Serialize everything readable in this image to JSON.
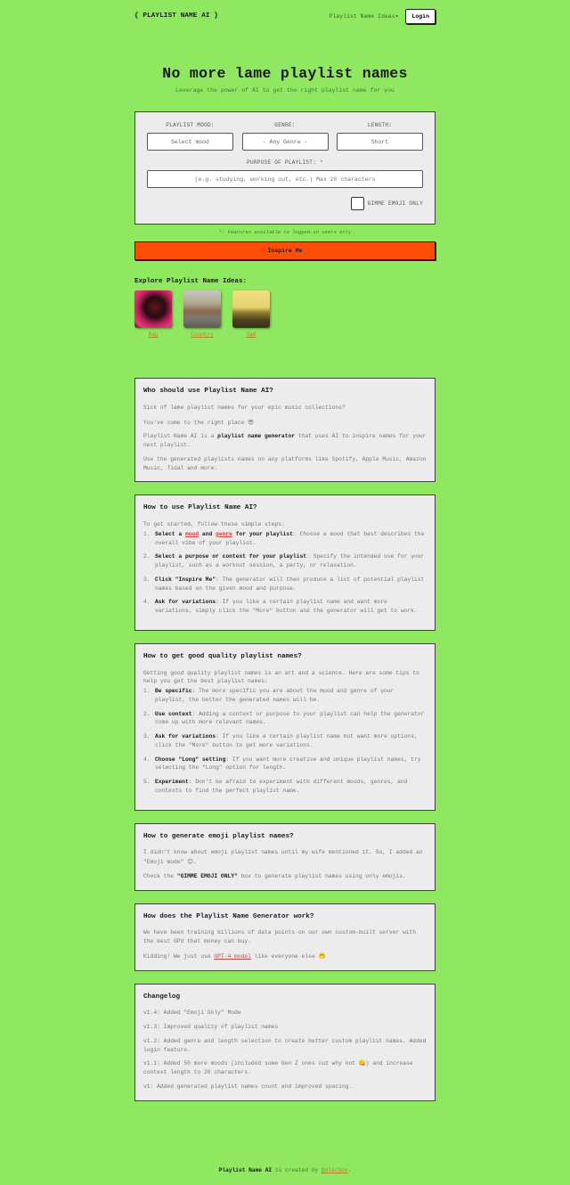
{
  "nav": {
    "logo": "{ PLAYLIST NAME AI }",
    "ideas_link": "Playlist Name Ideas",
    "ideas_caret": "▾",
    "login": "Login"
  },
  "hero": {
    "title": "No more lame playlist names",
    "subtitle": "Leverage the power of AI to get the right playlist name for you"
  },
  "form": {
    "mood_label": "PLAYLIST MOOD:",
    "mood_value": "Select mood",
    "genre_label": "GENRE:",
    "genre_value": "- Any Genre -",
    "length_label": "LENGTH:",
    "length_value": "Short",
    "purpose_label": "PURPOSE OF PLAYLIST:",
    "purpose_required": "*",
    "purpose_placeholder": "(e.g. studying, working out, etc.) Max 20 characters",
    "emoji_label": "GIMME EMOJI ONLY",
    "emoji_checked": false,
    "note": "*: Features available to logged-in users only",
    "inspire": "Inspire Me"
  },
  "explore": {
    "title": "Explore Playlist Name Ideas:",
    "items": [
      {
        "label": "Rap"
      },
      {
        "label": "Country"
      },
      {
        "label": "Sad"
      }
    ]
  },
  "who": {
    "title": "Who should use Playlist Name AI?",
    "p1": "Sick of lame playlist names for your epic music collections?",
    "p2": "You've come to the right place ",
    "p2_emoji": "😎",
    "p3_a": "Playlist Name AI is a ",
    "p3_b": "playlist name generator",
    "p3_c": " that uses AI to inspire names for your next playlist.",
    "p4": "Use the generated playlists names on any platforms like Spotify, Apple Music, Amazon Music, Tidal and more."
  },
  "howto": {
    "title": "How to use Playlist Name AI?",
    "intro": "To get started, follow these simple steps:",
    "s1_num": "1.",
    "s1_a": "Select a ",
    "s1_mood": "mood",
    "s1_and": " and ",
    "s1_genre": "genre",
    "s1_b": " for your playlist",
    "s1_text": ": Choose a mood that best describes the overall vibe of your playlist.",
    "s2_num": "2.",
    "s2_b": "Select a purpose or context for your playlist",
    "s2_text": ": Specify the intended use for your playlist, such as a workout session, a party, or relaxation.",
    "s3_num": "3.",
    "s3_b": "Click \"Inspire Me\"",
    "s3_text": ": The generator will then produce a list of potential playlist names based on the given mood and purpose.",
    "s4_num": "4.",
    "s4_b": "Ask for variations",
    "s4_text": ": If you like a certain playlist name and want more variations, simply click the \"More\" button and the generator will get to work."
  },
  "quality": {
    "title": "How to get good quality playlist names?",
    "intro": "Getting good quality playlist names is an art and a science. Here are some tips to help you get the best playlist names:",
    "tips": [
      {
        "num": "1.",
        "b": "Be specific",
        "text": ": The more specific you are about the mood and genre of your playlist, the better the generated names will be."
      },
      {
        "num": "2.",
        "b": "Use context",
        "text": ": Adding a context or purpose to your playlist can help the generator come up with more relevant names."
      },
      {
        "num": "3.",
        "b": "Ask for variations",
        "text": ": If you like a certain playlist name but want more options, click the \"More\" button to get more variations."
      },
      {
        "num": "4.",
        "b": "Choose \"Long\" setting",
        "text": ": If you want more creative and unique playlist names, try selecting the \"Long\" option for length."
      },
      {
        "num": "5.",
        "b": "Experiment",
        "text": ": Don't be afraid to experiment with different moods, genres, and contexts to find the perfect playlist name."
      }
    ]
  },
  "emoji": {
    "title": "How to generate emoji playlist names?",
    "p1": "I didn't know about emoji playlist names until my wife mentioned it. So, I added an \"Emoji mode\" ",
    "p1_emoji": "😊",
    "p1_end": ".",
    "p2_a": "Check the ",
    "p2_b": "\"GIMME EMOJI ONLY\"",
    "p2_c": " box to generate playlist names using only emojis."
  },
  "works": {
    "title": "How does the Playlist Name Generator work?",
    "p1": "We have been training billions of data points on our own custom-built server with the best GPU that money can buy.",
    "p2_a": "Kidding! We just use ",
    "p2_link": "GPT-4 model",
    "p2_c": " like everyone else ",
    "p2_emoji": "🤭"
  },
  "changelog": {
    "title": "Changelog",
    "entries": [
      {
        "text": "v1.4: Added \"Emoji Only\" Mode"
      },
      {
        "text": "v1.3: Improved quality of playlist names"
      },
      {
        "text": "v1.2: Added genre and length selection to create better custom playlist names. Added login feature."
      },
      {
        "text": "v1.1: Added 50 more moods (included some Gen Z ones cuz why not 😋) and increase context length to 20 characters."
      },
      {
        "text": "v1: Added generated playlist names count and improved spacing."
      }
    ]
  },
  "footer": {
    "brand": "Playlist Name AI",
    "text": " is created by ",
    "author": "@dlarbox",
    "end": "."
  }
}
